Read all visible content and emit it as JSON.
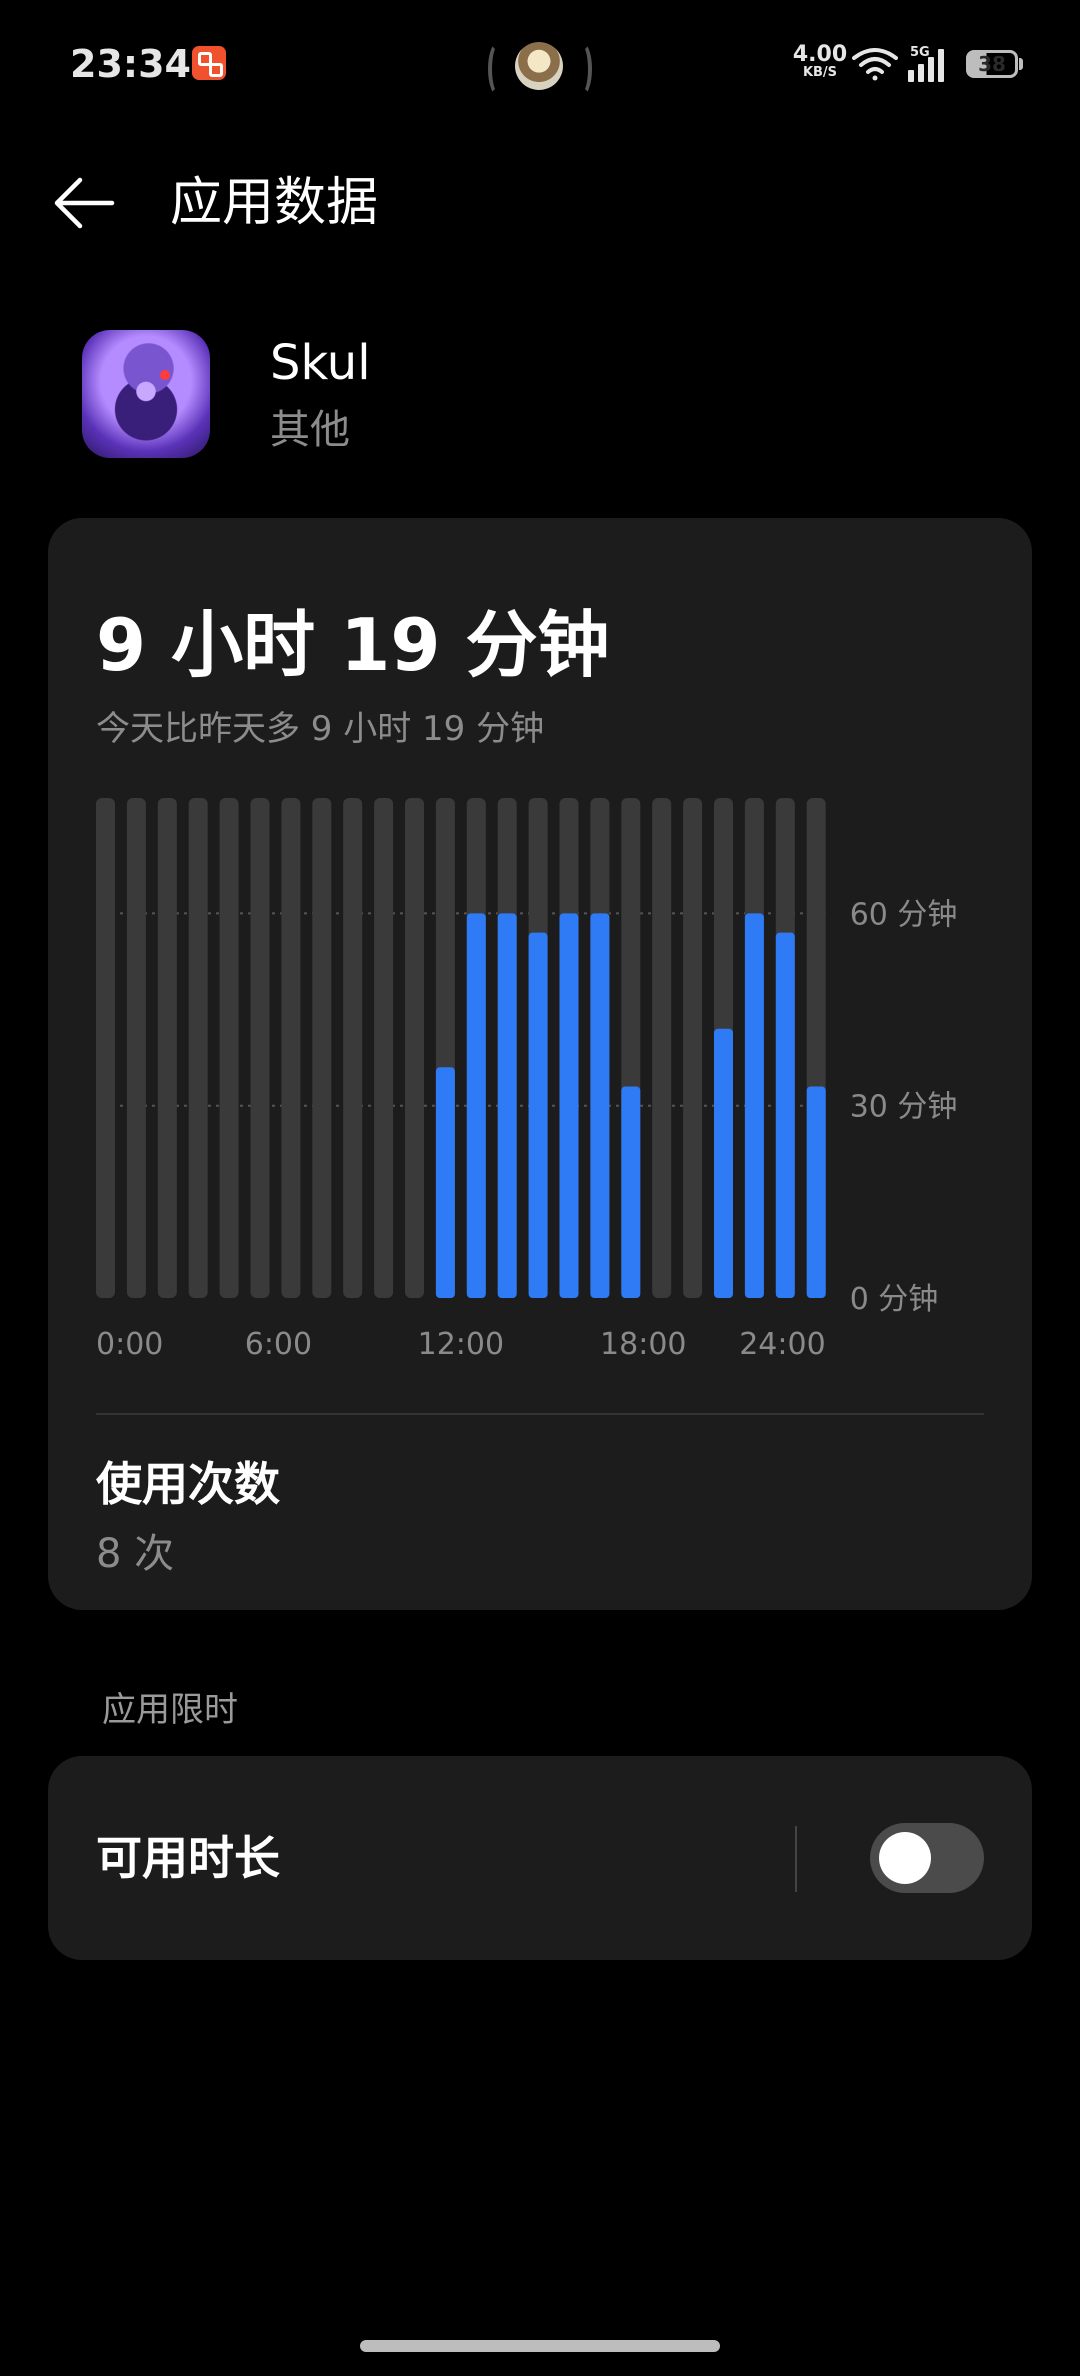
{
  "status_bar": {
    "time": "23:34",
    "net_speed_value": "4.00",
    "net_speed_unit": "KB/S",
    "network_type": "5G",
    "battery": "38",
    "icons": [
      "notification-app-icon",
      "wifi-icon",
      "signal-icon",
      "battery-icon"
    ]
  },
  "header": {
    "back_icon": "back-arrow-icon",
    "title": "应用数据"
  },
  "app": {
    "name": "Skul",
    "category": "其他"
  },
  "usage": {
    "total": "9 小时 19 分钟",
    "comparison": "今天比昨天多 9 小时 19 分钟",
    "count_label": "使用次数",
    "count_value": "8 次"
  },
  "chart_data": {
    "type": "bar",
    "categories": [
      "0",
      "1",
      "2",
      "3",
      "4",
      "5",
      "6",
      "7",
      "8",
      "9",
      "10",
      "11",
      "12",
      "13",
      "14",
      "15",
      "16",
      "17",
      "18",
      "19",
      "20",
      "21",
      "22",
      "23"
    ],
    "series": [
      {
        "values": [
          0,
          0,
          0,
          0,
          0,
          0,
          0,
          0,
          0,
          0,
          0,
          36,
          60,
          60,
          57,
          60,
          60,
          33,
          0,
          0,
          42,
          60,
          57,
          33
        ]
      }
    ],
    "x_tick_labels": [
      "0:00",
      "6:00",
      "12:00",
      "18:00",
      "24:00"
    ],
    "y_tick_labels": [
      "60 分钟",
      "30 分钟",
      "0 分钟"
    ],
    "y_ticks": [
      60,
      30,
      0
    ],
    "ylim": [
      0,
      78
    ],
    "grid": true,
    "colors": {
      "bar": "#2f7bf6",
      "track": "#3a3a3a",
      "grid": "#555555"
    }
  },
  "limits": {
    "section_title": "应用限时",
    "available_duration_label": "可用时长",
    "toggle_on": false
  }
}
